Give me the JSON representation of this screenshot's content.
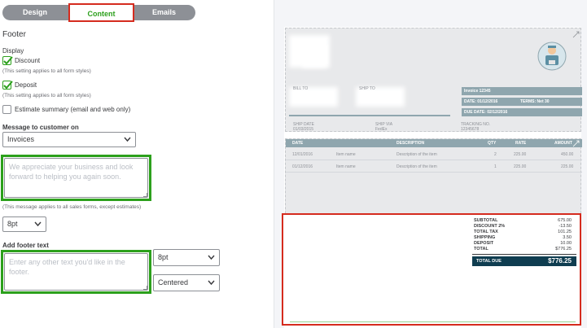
{
  "tabs": {
    "design": "Design",
    "content": "Content",
    "emails": "Emails"
  },
  "left": {
    "footer_title": "Footer",
    "display_label": "Display",
    "discount_label": "Discount",
    "discount_note": "(This setting applies to all form styles)",
    "deposit_label": "Deposit",
    "deposit_note": "(This setting applies to all form styles)",
    "estimate_label": "Estimate summary (email and web only)",
    "message_label": "Message to customer on",
    "message_select": "Invoices",
    "message_placeholder": "We appreciate your business and look forward to helping you again soon.",
    "message_note": "(This message applies to all sales forms, except estimates)",
    "font_size_1": "8pt",
    "footer_text_label": "Add footer text",
    "footer_placeholder": "Enter any other text you'd like in the footer.",
    "font_size_2": "8pt",
    "alignment": "Centered"
  },
  "preview": {
    "bill_to": "BILL TO",
    "ship_to": "SHIP TO",
    "invoice_no": "Invoice 12345",
    "date_label": "DATE: 01/12/2016",
    "terms": "TERMS: Net 30",
    "due_date": "DUE DATE: 02/12/2016",
    "ship_date_label": "SHIP DATE",
    "ship_date": "01/03/2015",
    "ship_via_label": "SHIP VIA",
    "ship_via": "FedEx",
    "tracking_label": "TRACKING NO.",
    "tracking": "12345678",
    "columns": {
      "date": "DATE",
      "description": "DESCRIPTION",
      "qty": "QTY",
      "rate": "RATE",
      "amount": "AMOUNT"
    },
    "rows": [
      {
        "date": "12/01/2016",
        "item": "Item name",
        "description": "Description of the item",
        "qty": "2",
        "rate": "225.00",
        "amount": "450.00"
      },
      {
        "date": "01/12/2016",
        "item": "Item name",
        "description": "Description of the item",
        "qty": "1",
        "rate": "225.00",
        "amount": "225.00"
      }
    ],
    "totals": [
      {
        "label": "SUBTOTAL",
        "value": "675.00"
      },
      {
        "label": "DISCOUNT 2%",
        "value": "-13.50"
      },
      {
        "label": "TOTAL TAX",
        "value": "101.25"
      },
      {
        "label": "SHIPPING",
        "value": "3.50"
      },
      {
        "label": "DEPOSIT",
        "value": "10.00"
      },
      {
        "label": "TOTAL",
        "value": "$776.25"
      }
    ],
    "total_due_label": "TOTAL DUE",
    "total_due_value": "$776.25"
  },
  "colors": {
    "accent": "#2ca01c",
    "highlight": "#d52b1e",
    "table_header": "#8fa6ae",
    "total_due_bg": "#0f3d50"
  }
}
